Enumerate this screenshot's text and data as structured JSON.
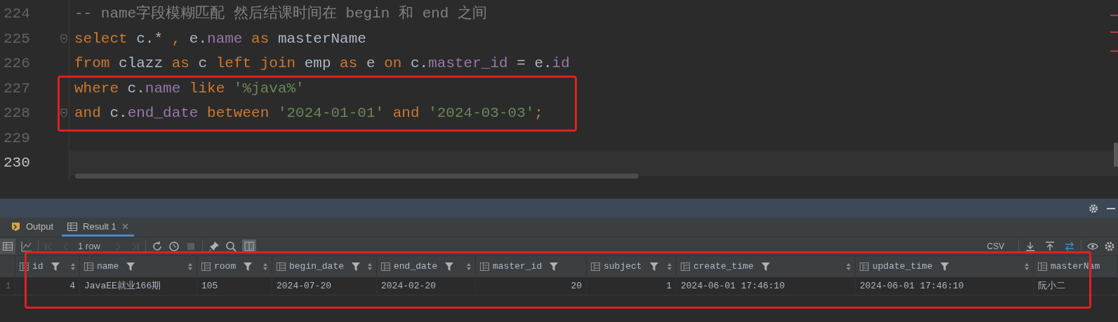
{
  "editor": {
    "lines": [
      {
        "number": "224",
        "current": false,
        "fold": false,
        "tokens": [
          {
            "kind": "comment",
            "text": "-- name字段模糊匹配 然后结课时间在 begin 和 end 之间"
          }
        ]
      },
      {
        "number": "225",
        "current": false,
        "fold": true,
        "tokens": [
          {
            "kind": "keyword",
            "text": "select"
          },
          {
            "kind": "plain",
            "text": " c.* "
          },
          {
            "kind": "keyword",
            "text": ","
          },
          {
            "kind": "plain",
            "text": " e."
          },
          {
            "kind": "field",
            "text": "name"
          },
          {
            "kind": "keyword",
            "text": " as"
          },
          {
            "kind": "plain",
            "text": " masterName"
          }
        ]
      },
      {
        "number": "226",
        "current": false,
        "fold": false,
        "tokens": [
          {
            "kind": "keyword",
            "text": "from"
          },
          {
            "kind": "plain",
            "text": " clazz "
          },
          {
            "kind": "keyword",
            "text": "as"
          },
          {
            "kind": "plain",
            "text": " c "
          },
          {
            "kind": "keyword",
            "text": "left join"
          },
          {
            "kind": "plain",
            "text": " emp "
          },
          {
            "kind": "keyword",
            "text": "as"
          },
          {
            "kind": "plain",
            "text": " e "
          },
          {
            "kind": "keyword",
            "text": "on"
          },
          {
            "kind": "plain",
            "text": " c."
          },
          {
            "kind": "field",
            "text": "master_id"
          },
          {
            "kind": "plain",
            "text": " = e."
          },
          {
            "kind": "field",
            "text": "id"
          }
        ]
      },
      {
        "number": "227",
        "current": false,
        "fold": false,
        "tokens": [
          {
            "kind": "keyword",
            "text": "where"
          },
          {
            "kind": "plain",
            "text": " c."
          },
          {
            "kind": "field",
            "text": "name"
          },
          {
            "kind": "keyword",
            "text": " like"
          },
          {
            "kind": "string",
            "text": " '%java%'"
          }
        ]
      },
      {
        "number": "228",
        "current": false,
        "fold": true,
        "tokens": [
          {
            "kind": "keyword",
            "text": "and"
          },
          {
            "kind": "plain",
            "text": " c."
          },
          {
            "kind": "field",
            "text": "end_date"
          },
          {
            "kind": "keyword",
            "text": " between"
          },
          {
            "kind": "string",
            "text": " '2024-01-01'"
          },
          {
            "kind": "keyword",
            "text": " and"
          },
          {
            "kind": "string",
            "text": " '2024-03-03'"
          },
          {
            "kind": "keyword",
            "text": ";"
          }
        ]
      },
      {
        "number": "229",
        "current": false,
        "fold": false
      },
      {
        "number": "230",
        "current": true,
        "fold": false
      }
    ]
  },
  "tabs": [
    {
      "label": "Output",
      "selected": false,
      "closable": false
    },
    {
      "label": "Result 1",
      "selected": true,
      "closable": true
    }
  ],
  "toolbar": {
    "row_count": "1 row",
    "format": "CSV",
    "navigation_disabled": true,
    "layout_toggle_on": true
  },
  "table": {
    "columns": [
      {
        "label": "id",
        "kind": "number",
        "sortable": true
      },
      {
        "label": "name",
        "kind": "text",
        "sortable": true
      },
      {
        "label": "room",
        "kind": "text",
        "sortable": true
      },
      {
        "label": "begin_date",
        "kind": "text",
        "sortable": true
      },
      {
        "label": "end_date",
        "kind": "text",
        "sortable": true
      },
      {
        "label": "master_id",
        "kind": "number",
        "sortable": false
      },
      {
        "label": "subject",
        "kind": "number",
        "sortable": true
      },
      {
        "label": "create_time",
        "kind": "text",
        "sortable": true
      },
      {
        "label": "update_time",
        "kind": "text",
        "sortable": true
      },
      {
        "label": "masterNam",
        "kind": "text",
        "sortable": false
      }
    ],
    "rows": [
      {
        "number": "1",
        "cells": [
          "4",
          "JavaEE就业166期",
          "105",
          "2024-07-20",
          "2024-02-20",
          "20",
          "1",
          "2024-06-01 17:46:10",
          "2024-06-01 17:46:10",
          "阮小二"
        ]
      }
    ]
  }
}
